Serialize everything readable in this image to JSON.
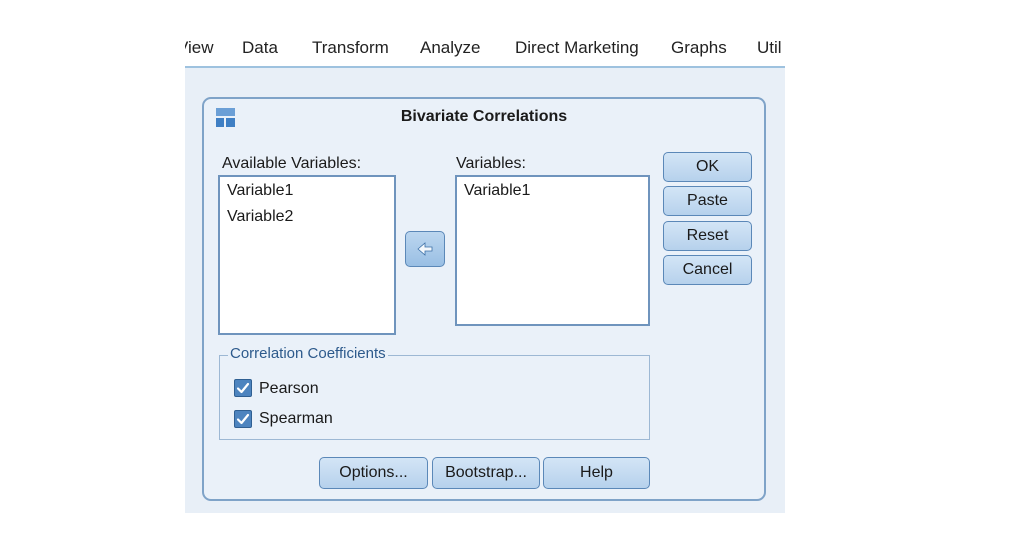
{
  "menu": {
    "items": [
      "View",
      "Data",
      "Transform",
      "Analyze",
      "Direct Marketing",
      "Graphs",
      "Util"
    ]
  },
  "dialog": {
    "title": "Bivariate Correlations",
    "available_label": "Available Variables:",
    "available_items": [
      "Variable1",
      "Variable2"
    ],
    "variables_label": "Variables:",
    "selected_items": [
      "Variable1"
    ],
    "buttons": {
      "ok": "OK",
      "paste": "Paste",
      "reset": "Reset",
      "cancel": "Cancel",
      "options": "Options...",
      "bootstrap": "Bootstrap...",
      "help": "Help"
    },
    "coefficients": {
      "label": "Correlation Coefficients",
      "pearson": {
        "label": "Pearson",
        "checked": true
      },
      "spearman": {
        "label": "Spearman",
        "checked": true
      }
    }
  },
  "colors": {
    "accent": "#4d84bf",
    "dialog_bg": "#eaf1f9",
    "button_bg": "#c6dcf2",
    "border": "#6f94bd"
  }
}
